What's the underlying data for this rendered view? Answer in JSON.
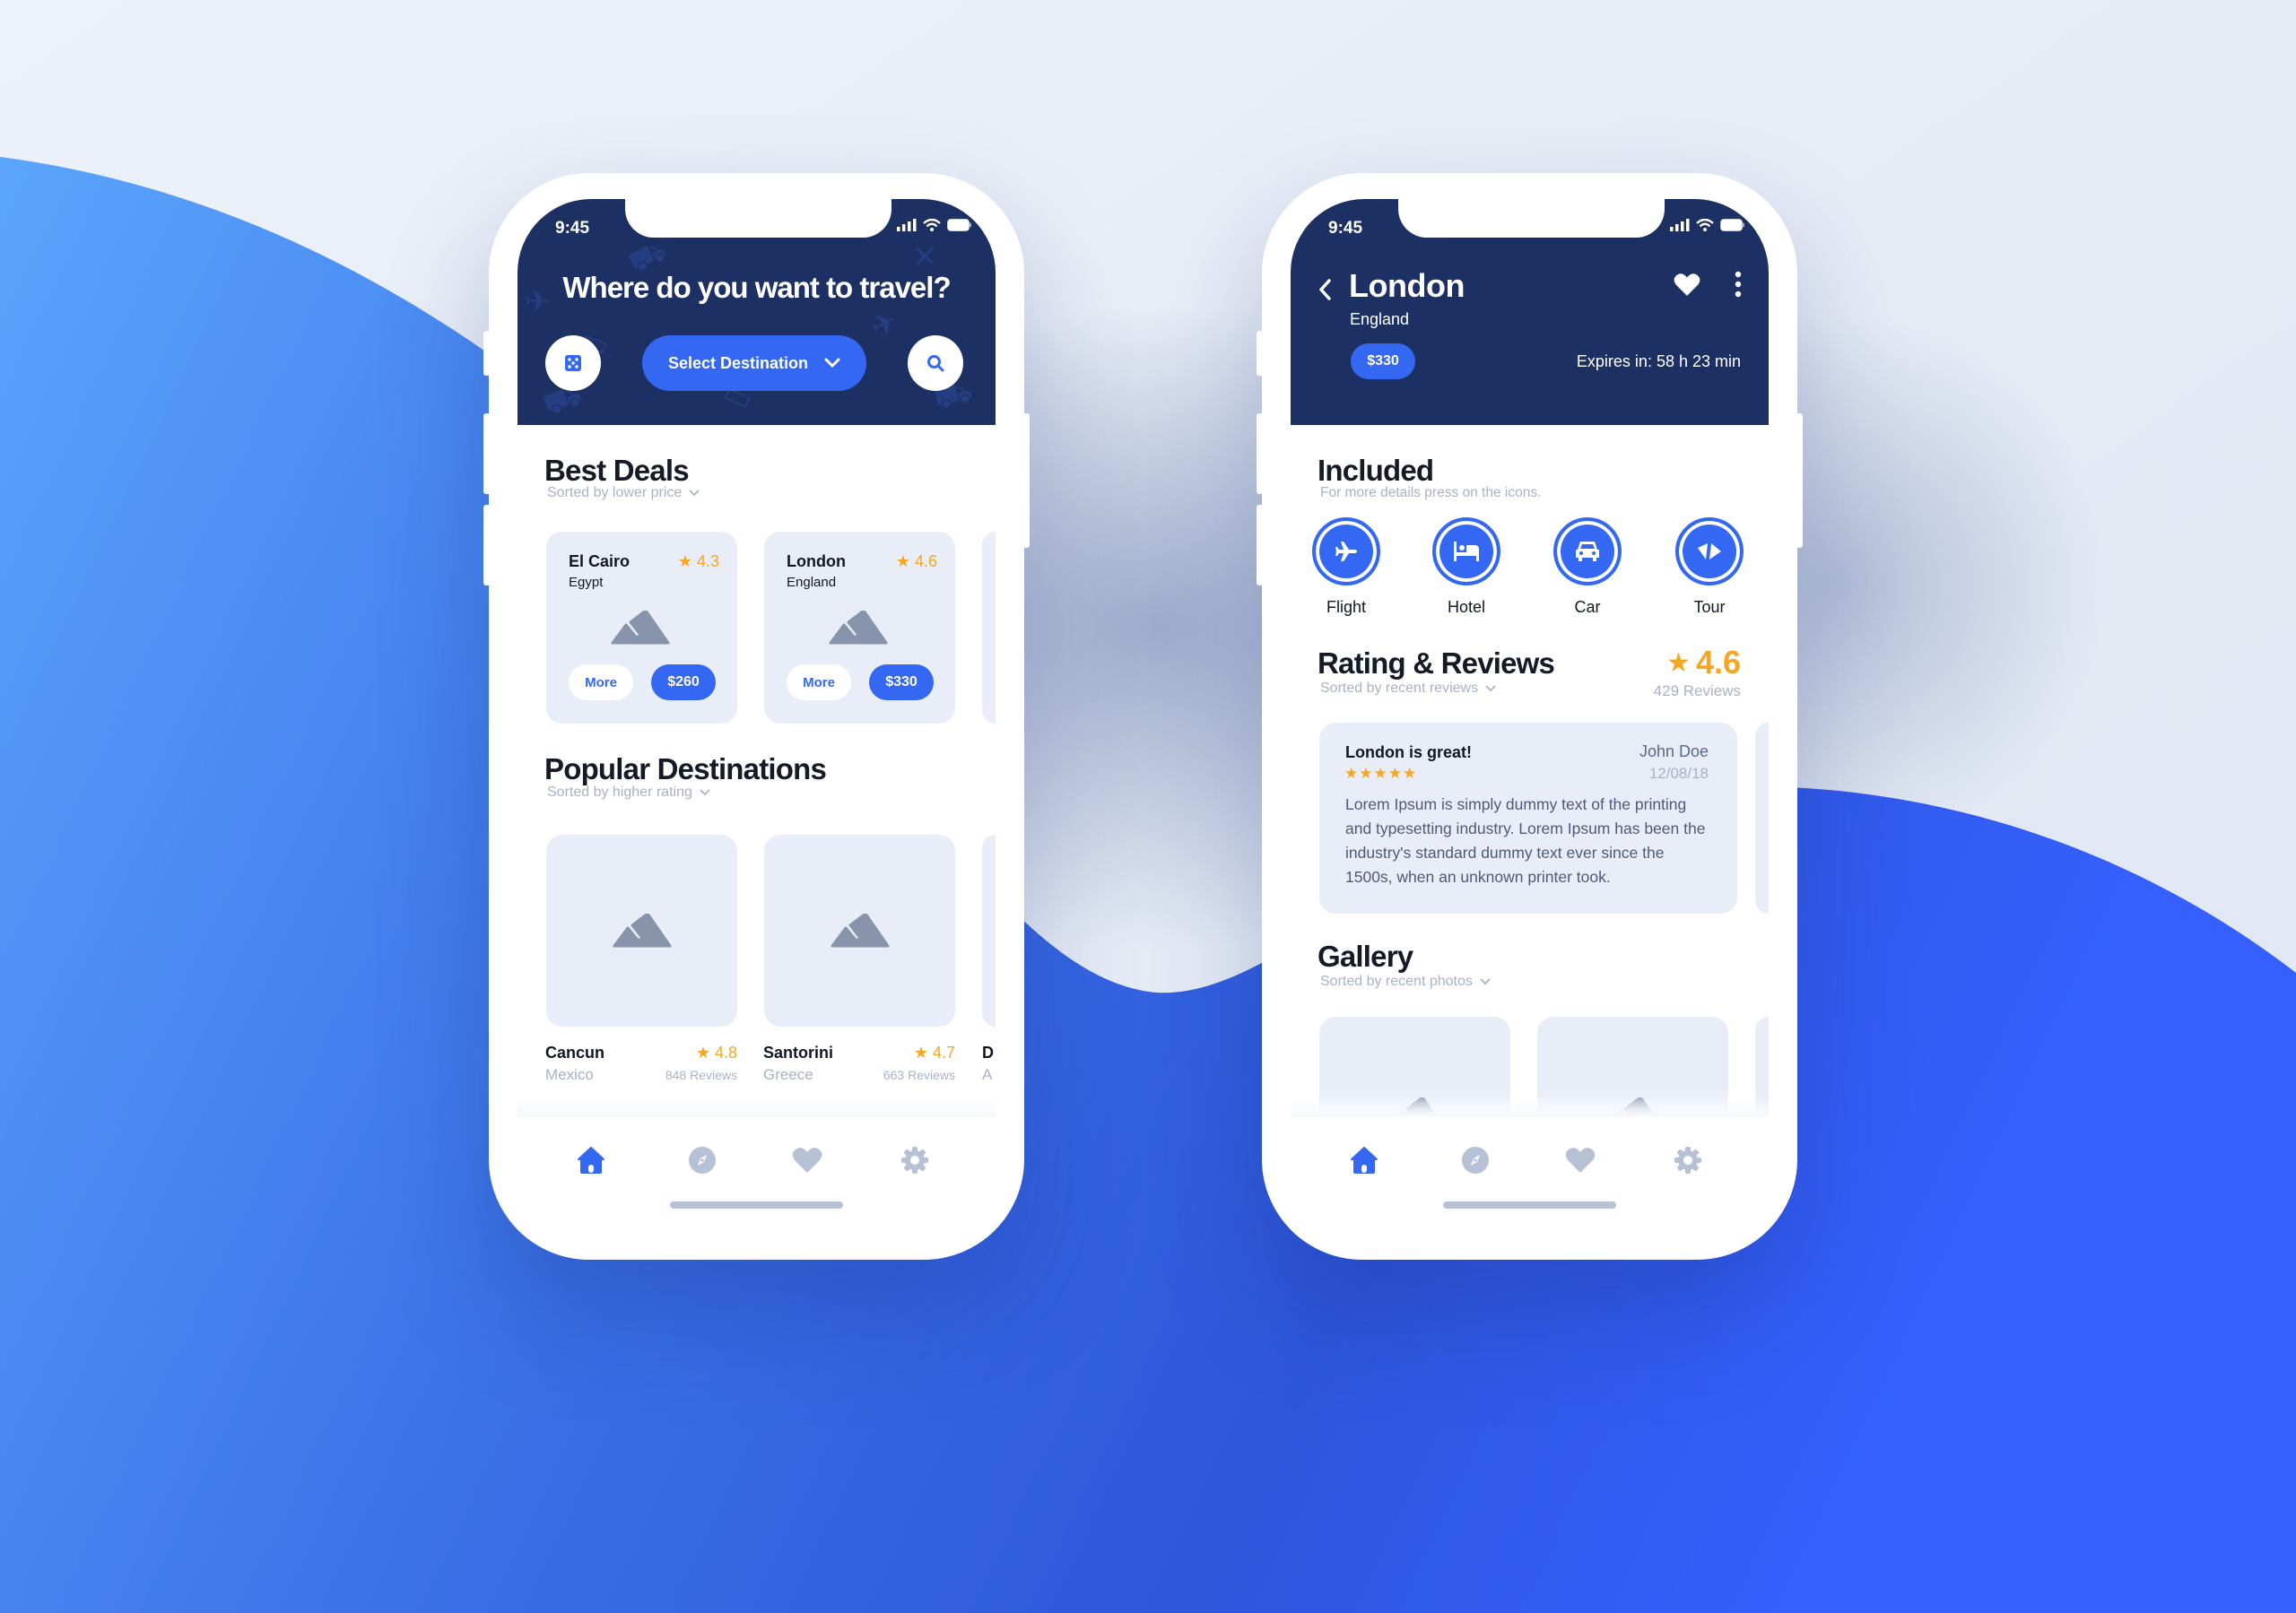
{
  "colors": {
    "header_bg": "#1c3064",
    "accent": "#3468f2",
    "star": "#f5a623",
    "muted": "#a9b2c4",
    "card_bg": "#e8edf7",
    "tab_inactive": "#b7c1d6"
  },
  "phone_home": {
    "status": {
      "time": "9:45",
      "icons": [
        "signal-icon",
        "wifi-icon",
        "battery-icon"
      ]
    },
    "header": {
      "title": "Where do you want to travel?",
      "random_button_icon": "dice-icon",
      "select_label": "Select Destination",
      "search_button_icon": "search-icon"
    },
    "best_deals": {
      "title": "Best Deals",
      "sort_label": "Sorted by lower price",
      "cards": [
        {
          "city": "El Cairo",
          "country": "Egypt",
          "rating": "4.3",
          "more_label": "More",
          "price": "$260"
        },
        {
          "city": "London",
          "country": "England",
          "rating": "4.6",
          "more_label": "More",
          "price": "$330"
        }
      ]
    },
    "popular": {
      "title": "Popular Destinations",
      "sort_label": "Sorted by higher rating",
      "items": [
        {
          "city": "Cancun",
          "country": "Mexico",
          "rating": "4.8",
          "reviews": "848 Reviews"
        },
        {
          "city": "Santorini",
          "country": "Greece",
          "rating": "4.7",
          "reviews": "663 Reviews"
        },
        {
          "city": "D",
          "country": "A"
        }
      ]
    },
    "tabbar": {
      "tabs": [
        "home",
        "explore",
        "favorites",
        "settings"
      ],
      "active": "home"
    }
  },
  "phone_detail": {
    "status": {
      "time": "9:45"
    },
    "header": {
      "city": "London",
      "country": "England",
      "price": "$330",
      "expires": "Expires in: 58 h 23 min"
    },
    "included": {
      "title": "Included",
      "subtitle": "For more details press on the icons.",
      "items": [
        {
          "label": "Flight",
          "icon": "plane-icon"
        },
        {
          "label": "Hotel",
          "icon": "bed-icon"
        },
        {
          "label": "Car",
          "icon": "car-icon"
        },
        {
          "label": "Tour",
          "icon": "tour-icon"
        }
      ]
    },
    "reviews": {
      "title": "Rating & Reviews",
      "sort_label": "Sorted by recent reviews",
      "rating": "4.6",
      "count": "429 Reviews",
      "card": {
        "title": "London is great!",
        "stars": 5,
        "stars_text": "★★★★★",
        "author": "John Doe",
        "date": "12/08/18",
        "body": "Lorem Ipsum is simply dummy text of the printing and typesetting industry. Lorem Ipsum has been the industry's standard dummy text ever since the 1500s, when an unknown printer took."
      }
    },
    "gallery": {
      "title": "Gallery",
      "sort_label": "Sorted by recent photos"
    },
    "tabbar": {
      "tabs": [
        "home",
        "explore",
        "favorites",
        "settings"
      ],
      "active": "home"
    }
  }
}
